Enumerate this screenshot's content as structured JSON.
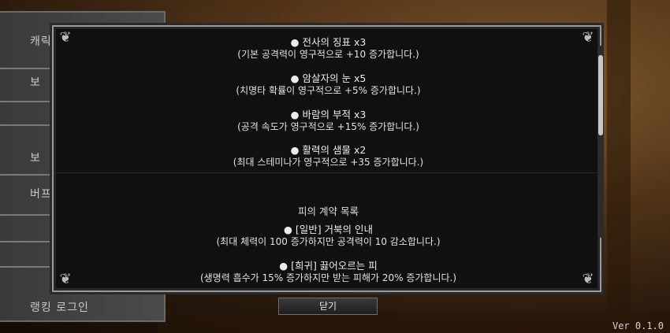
{
  "left_menu": {
    "items": [
      {
        "label": "캐릭"
      },
      {
        "label": "보"
      },
      {
        "label": "보"
      },
      {
        "label": "버프"
      },
      {
        "label": "랭킹 로그인"
      }
    ]
  },
  "panel": {
    "upper_entries": [
      {
        "title": "● 전사의 징표 x3",
        "desc": "(기본 공격력이 영구적으로 +10 증가합니다.)"
      },
      {
        "title": "● 암살자의 눈 x5",
        "desc": "(치명타 확률이 영구적으로 +5% 증가합니다.)"
      },
      {
        "title": "● 바람의 부적 x3",
        "desc": "(공격 속도가 영구적으로 +15% 증가합니다.)"
      },
      {
        "title": "● 활력의 샘물 x2",
        "desc": "(최대 스테미나가 영구적으로 +35 증가합니다.)"
      }
    ],
    "section_title": "피의 계약 목록",
    "contract_entries": [
      {
        "title": "● [일반] 거북의 인내",
        "desc": "(최대 체력이 100 증가하지만 공격력이 10 감소합니다.)"
      },
      {
        "title": "● [희귀] 끓어오르는 피",
        "desc": "(생명력 흡수가 15% 증가하지만 받는 피해가 20% 증가합니다.)"
      }
    ],
    "close_label": "닫기"
  },
  "version": "Ver 0.1.0"
}
